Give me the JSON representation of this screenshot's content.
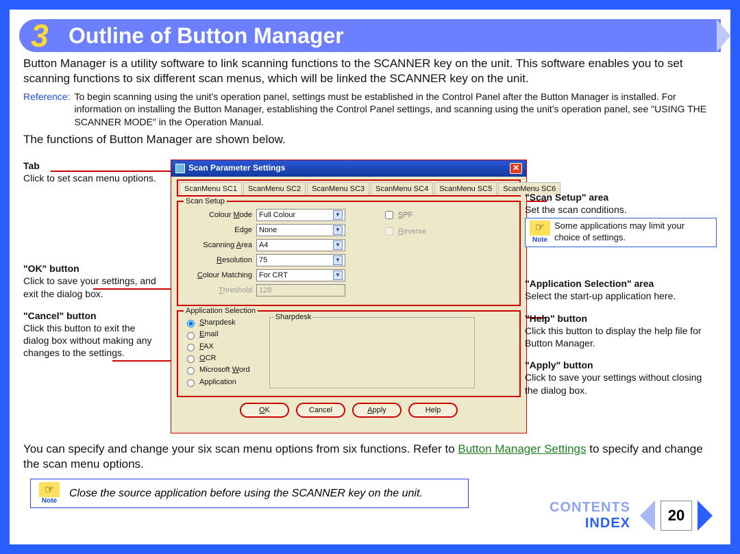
{
  "header": {
    "number": "3",
    "title": "Outline of Button Manager"
  },
  "intro": "Button Manager is a utility software to link scanning functions to the SCANNER key on the unit. This software enables you to set scanning functions to six different scan menus, which will be linked the SCANNER key on the unit.",
  "reference_label": "Reference:",
  "reference_text": "To begin scanning using the unit's operation panel, settings must be established in the Control Panel after the Button Manager is installed. For information on installing the Button Manager, establishing the Control Panel settings, and scanning using the unit's operation panel, see \"USING THE SCANNER MODE\" in the Operation Manual.",
  "funcs_line": "The functions of Button Manager are shown below.",
  "callouts_left": {
    "tab": {
      "title": "Tab",
      "text": "Click to set scan menu options."
    },
    "ok": {
      "title": "\"OK\" button",
      "text": "Click to save your settings, and exit the dialog box."
    },
    "cancel": {
      "title": "\"Cancel\" button",
      "text": "Click this button to exit the dialog box without making any changes to the settings."
    }
  },
  "callouts_right": {
    "scan": {
      "title": "\"Scan Setup\" area",
      "text": "Set the scan conditions.",
      "note": "Some applications may limit your choice of settings."
    },
    "app": {
      "title": "\"Application Selection\" area",
      "text": "Select the start-up application here."
    },
    "help": {
      "title": "\"Help\" button",
      "text": "Click this button to display the help file for Button Manager."
    },
    "apply": {
      "title": "\"Apply\" button",
      "text": "Click to save your settings without closing the dialog box."
    }
  },
  "dialog": {
    "title": "Scan Parameter Settings",
    "tabs": [
      "ScanMenu SC1",
      "ScanMenu SC2",
      "ScanMenu SC3",
      "ScanMenu SC4",
      "ScanMenu SC5",
      "ScanMenu SC6"
    ],
    "groups": {
      "scan_setup_label": "Scan Setup",
      "colour_mode": {
        "label": "Colour Mode",
        "value": "Full Colour"
      },
      "edge": {
        "label": "Edge",
        "value": "None"
      },
      "scanning_area": {
        "label": "Scanning Area",
        "value": "A4"
      },
      "resolution": {
        "label": "Resolution",
        "value": "75"
      },
      "colour_matching": {
        "label": "Colour Matching",
        "value": "For CRT"
      },
      "threshold": {
        "label": "Threshold",
        "value": "128"
      },
      "spf": "SPF",
      "reverse": "Reverse",
      "app_selection_label": "Application Selection",
      "radios": [
        "Sharpdesk",
        "Email",
        "FAX",
        "OCR",
        "Microsoft Word",
        "Application"
      ],
      "app_sub_label": "Sharpdesk",
      "buttons": {
        "ok": "OK",
        "cancel": "Cancel",
        "apply": "Apply",
        "help": "Help"
      }
    }
  },
  "outro_a": "You can specify and change your six scan menu options from six functions. Refer to ",
  "outro_link": "Button Manager Settings",
  "outro_b": " to specify and change the scan menu options.",
  "bottom_note": "Close the source application before using the SCANNER key on the unit.",
  "note_label": "Note",
  "footer": {
    "contents": "CONTENTS",
    "index": "INDEX",
    "page": "20"
  }
}
